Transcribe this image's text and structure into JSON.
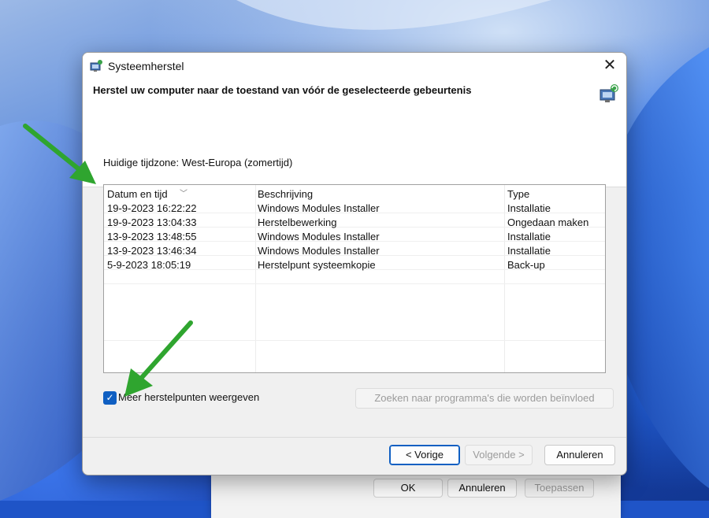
{
  "window": {
    "title": "Systeemherstel",
    "close_symbol": "✕"
  },
  "header": {
    "title": "Herstel uw computer naar de toestand van vóór de geselecteerde gebeurtenis"
  },
  "timezone_label": "Huidige tijdzone: West-Europa (zomertijd)",
  "table": {
    "columns": [
      "Datum en tijd",
      "Beschrijving",
      "Type"
    ],
    "sort_indicator": "﹀",
    "rows": [
      [
        "19-9-2023 16:22:22",
        "Windows Modules Installer",
        "Installatie"
      ],
      [
        "19-9-2023 13:04:33",
        "Herstelbewerking",
        "Ongedaan maken"
      ],
      [
        "13-9-2023 13:48:55",
        "Windows Modules Installer",
        "Installatie"
      ],
      [
        "13-9-2023 13:46:34",
        "Windows Modules Installer",
        "Installatie"
      ],
      [
        "5-9-2023 18:05:19",
        "Herstelpunt systeemkopie",
        "Back-up"
      ]
    ]
  },
  "checkbox": {
    "label": "Meer herstelpunten weergeven",
    "checked": true,
    "check_symbol": "✓"
  },
  "buttons": {
    "affected_programs": "Zoeken naar programma's die worden beïnvloed",
    "back": "< Vorige",
    "next": "Volgende >",
    "cancel": "Annuleren"
  },
  "background_dialog": {
    "ok": "OK",
    "cancel": "Annuleren",
    "apply": "Toepassen"
  },
  "colors": {
    "accent": "#0f5fc2",
    "annotation_arrow": "#2fa52f"
  },
  "icons": {
    "title": "system-restore-icon",
    "header": "system-restore-icon",
    "close": "close-icon"
  }
}
